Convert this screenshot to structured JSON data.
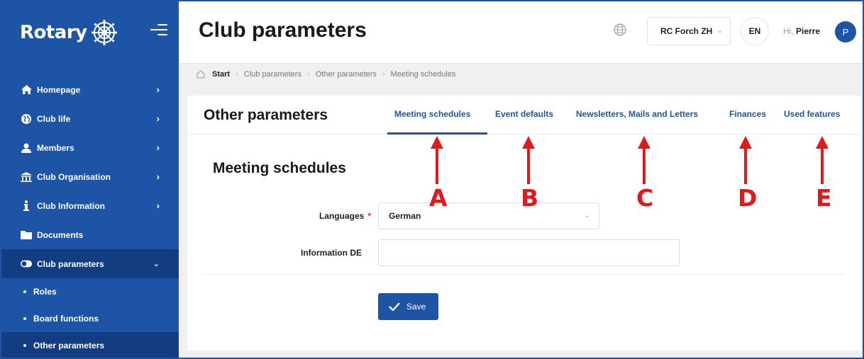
{
  "app": {
    "brand": "Rotary",
    "accent_color": "#1e54a5",
    "sidebar_active_color": "#123d80"
  },
  "sidebar": {
    "items": [
      {
        "label": "Homepage",
        "icon": "home-icon",
        "has_chevron": true
      },
      {
        "label": "Club life",
        "icon": "globe-icon",
        "has_chevron": true
      },
      {
        "label": "Members",
        "icon": "user-icon",
        "has_chevron": true
      },
      {
        "label": "Club Organisation",
        "icon": "institution-icon",
        "has_chevron": true
      },
      {
        "label": "Club Information",
        "icon": "info-icon",
        "has_chevron": true
      },
      {
        "label": "Documents",
        "icon": "folder-icon",
        "has_chevron": false
      },
      {
        "label": "Club parameters",
        "icon": "toggle-icon",
        "has_chevron": true,
        "expanded": true
      }
    ],
    "sub_items": [
      {
        "label": "Roles"
      },
      {
        "label": "Board functions"
      },
      {
        "label": "Other parameters",
        "active": true
      }
    ]
  },
  "header": {
    "title": "Club parameters",
    "club": "RC Forch ZH",
    "language": "EN",
    "greeting": "Hi,",
    "user_name": "Pierre",
    "avatar_initial": "P"
  },
  "breadcrumb": [
    "Start",
    "Club parameters",
    "Other parameters",
    "Meeting schedules"
  ],
  "card": {
    "title": "Other parameters",
    "tabs": [
      {
        "label": "Meeting schedules",
        "active": true
      },
      {
        "label": "Event defaults"
      },
      {
        "label": "Newsletters, Mails and Letters"
      },
      {
        "label": "Finances"
      },
      {
        "label": "Used features"
      }
    ]
  },
  "form": {
    "section_title": "Meeting schedules",
    "languages_label": "Languages",
    "required_mark": "*",
    "languages_value": "German",
    "information_label": "Information DE",
    "information_value": "",
    "save_label": "Save"
  },
  "annotations": {
    "color": "#e01a1a",
    "letters": [
      "A",
      "B",
      "C",
      "D",
      "E"
    ]
  }
}
